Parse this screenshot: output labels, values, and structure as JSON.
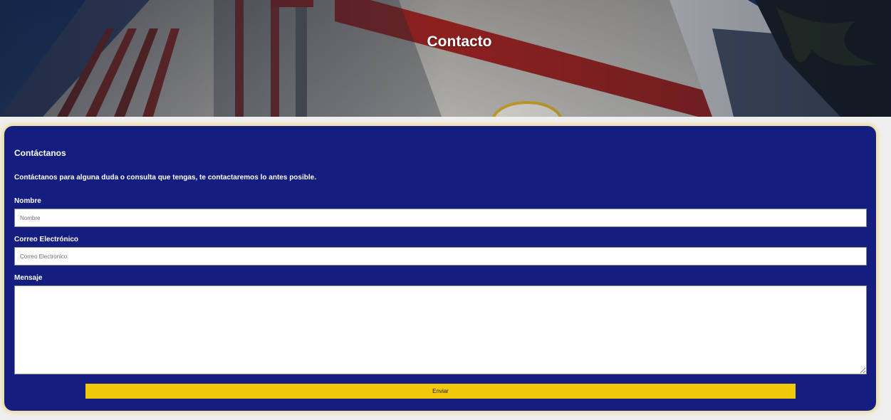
{
  "hero": {
    "title": "Contacto"
  },
  "contact_form": {
    "title": "Contáctanos",
    "description": "Contáctanos para alguna duda o consulta que tengas, te contactaremos lo antes posible.",
    "name_label": "Nombre",
    "name_placeholder": "Nombre",
    "email_label": "Correo Electrónico",
    "email_placeholder": "Correo Electronico",
    "message_label": "Mensaje",
    "message_value": "",
    "submit_label": "Enviar"
  },
  "colors": {
    "card_background": "#141e80",
    "card_glow": "#f1ca52",
    "submit_button": "#f2c80a",
    "page_background": "#efefef"
  }
}
